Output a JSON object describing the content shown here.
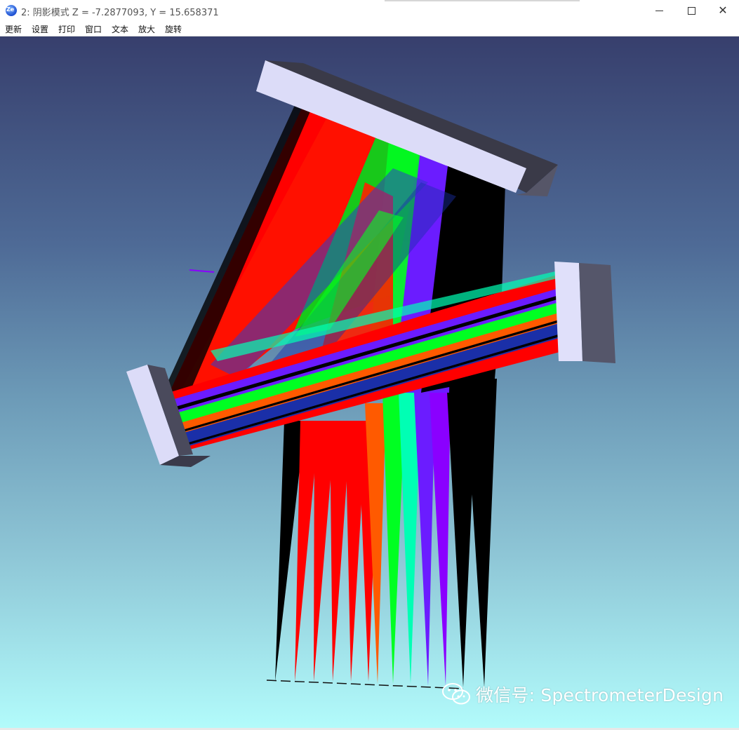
{
  "window": {
    "title": "2: 阴影模式 Z = -7.2877093, Y = 15.658371",
    "icon": "zemax-app-icon",
    "icon_text": "Ze",
    "controls": [
      "minimize-icon",
      "maximize-icon",
      "close-icon"
    ]
  },
  "menu": {
    "items": [
      "更新",
      "设置",
      "打印",
      "窗口",
      "文本",
      "放大",
      "旋转"
    ]
  },
  "viewport": {
    "mode": "shaded 3D layout",
    "background_top": "#373f6d",
    "background_bottom": "#b2fbfb",
    "mirror_color": "#dcdcf8",
    "mirror_shadow_color": "#4e4e60",
    "beam_colors": [
      "#000000",
      "#ff0000",
      "#ff5a00",
      "#00ff22",
      "#00ffb4",
      "#6b1cff",
      "#8a00ff"
    ]
  },
  "watermark": {
    "text": "微信号: SpectrometerDesign",
    "icon": "wechat-icon"
  }
}
